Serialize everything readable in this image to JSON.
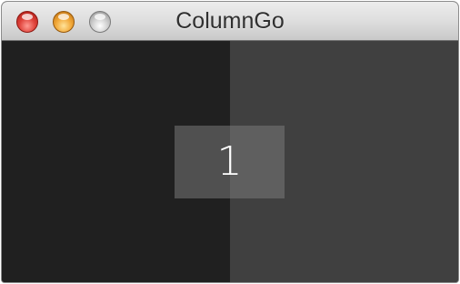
{
  "window": {
    "title": "ColumnGo",
    "controls": [
      "close-icon",
      "minimize-icon",
      "zoom-icon"
    ]
  },
  "game": {
    "tile_number": "1",
    "columns": [
      {
        "name": "left",
        "color": "#202020"
      },
      {
        "name": "right",
        "color": "#404040"
      }
    ]
  }
}
